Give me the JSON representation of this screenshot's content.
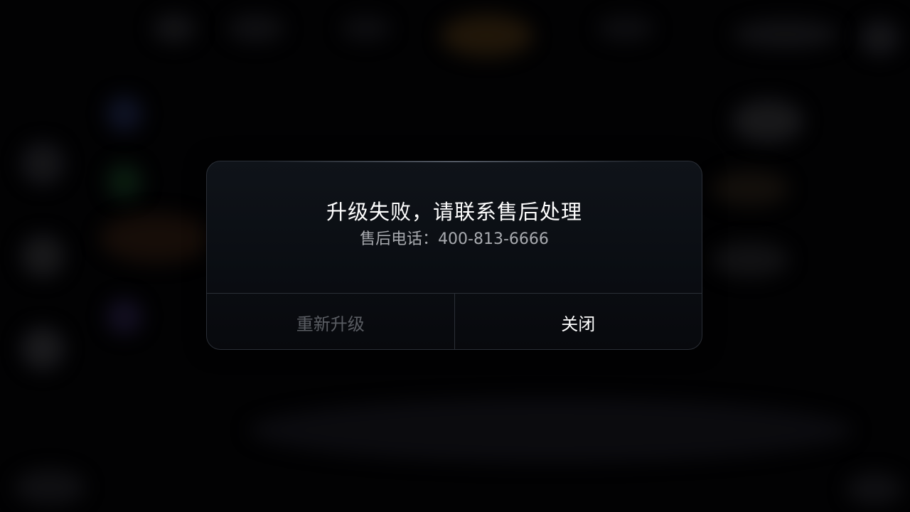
{
  "dialog": {
    "title": "升级失败，请联系售后处理",
    "subtitle": "售后电话：400-813-6666",
    "retry_label": "重新升级",
    "close_label": "关闭"
  },
  "colors": {
    "title": "#ffffff",
    "subtitle": "#a9abb0",
    "retry_disabled": "#5a5d63",
    "close": "#ffffff",
    "dialog_bg": "#0c1016",
    "border": "#2b2f37"
  }
}
